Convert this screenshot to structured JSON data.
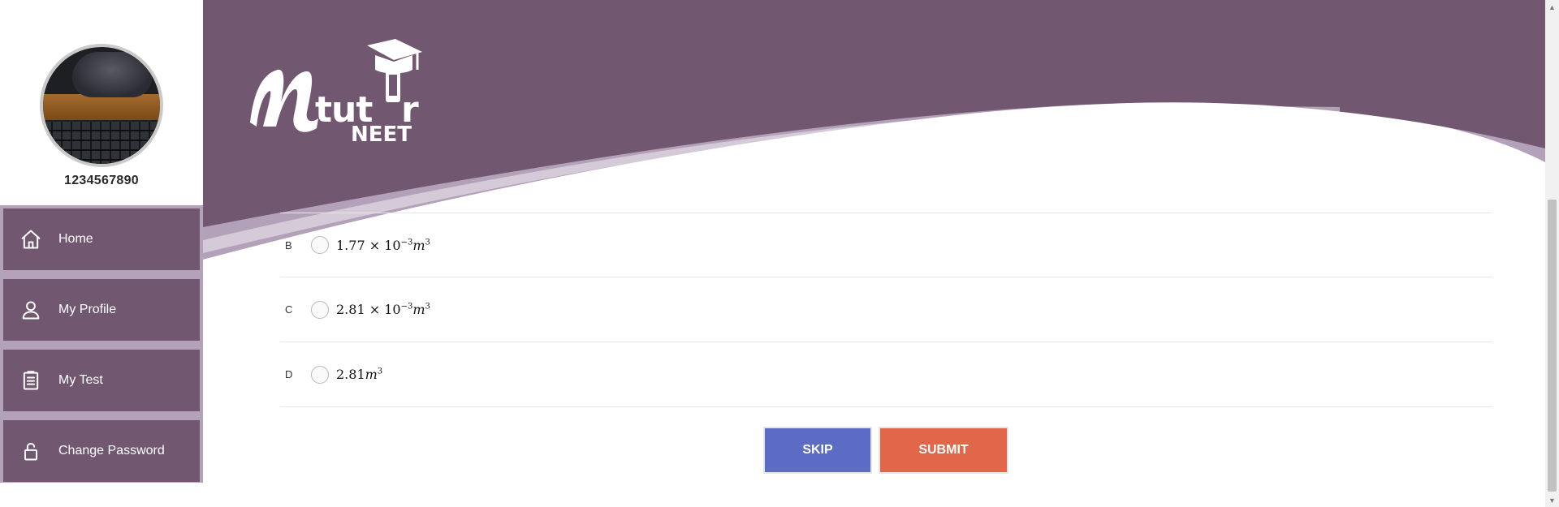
{
  "sidebar": {
    "user_id": "1234567890",
    "menu": [
      {
        "label": "Home",
        "icon": "home-icon"
      },
      {
        "label": "My Profile",
        "icon": "user-icon"
      },
      {
        "label": "My Test",
        "icon": "clipboard-icon"
      },
      {
        "label": "Change Password",
        "icon": "lock-icon"
      }
    ]
  },
  "brand": {
    "logo_text": "Mtutor",
    "logo_sub": "NEET"
  },
  "question": {
    "options": [
      {
        "letter": "B",
        "mantissa": "1.77",
        "times": "×",
        "base": "10",
        "exponent": "−3",
        "unit": "m",
        "unit_exp": "3"
      },
      {
        "letter": "C",
        "mantissa": "2.81",
        "times": "×",
        "base": "10",
        "exponent": "−3",
        "unit": "m",
        "unit_exp": "3"
      },
      {
        "letter": "D",
        "mantissa": "2.81",
        "unit": "m",
        "unit_exp": "3"
      }
    ]
  },
  "actions": {
    "skip_label": "SKIP",
    "submit_label": "SUBMIT"
  },
  "colors": {
    "header_purple": "#725770",
    "menu_bg": "#b4a2bb",
    "skip_blue": "#5c6bc4",
    "submit_orange": "#e1664a"
  }
}
